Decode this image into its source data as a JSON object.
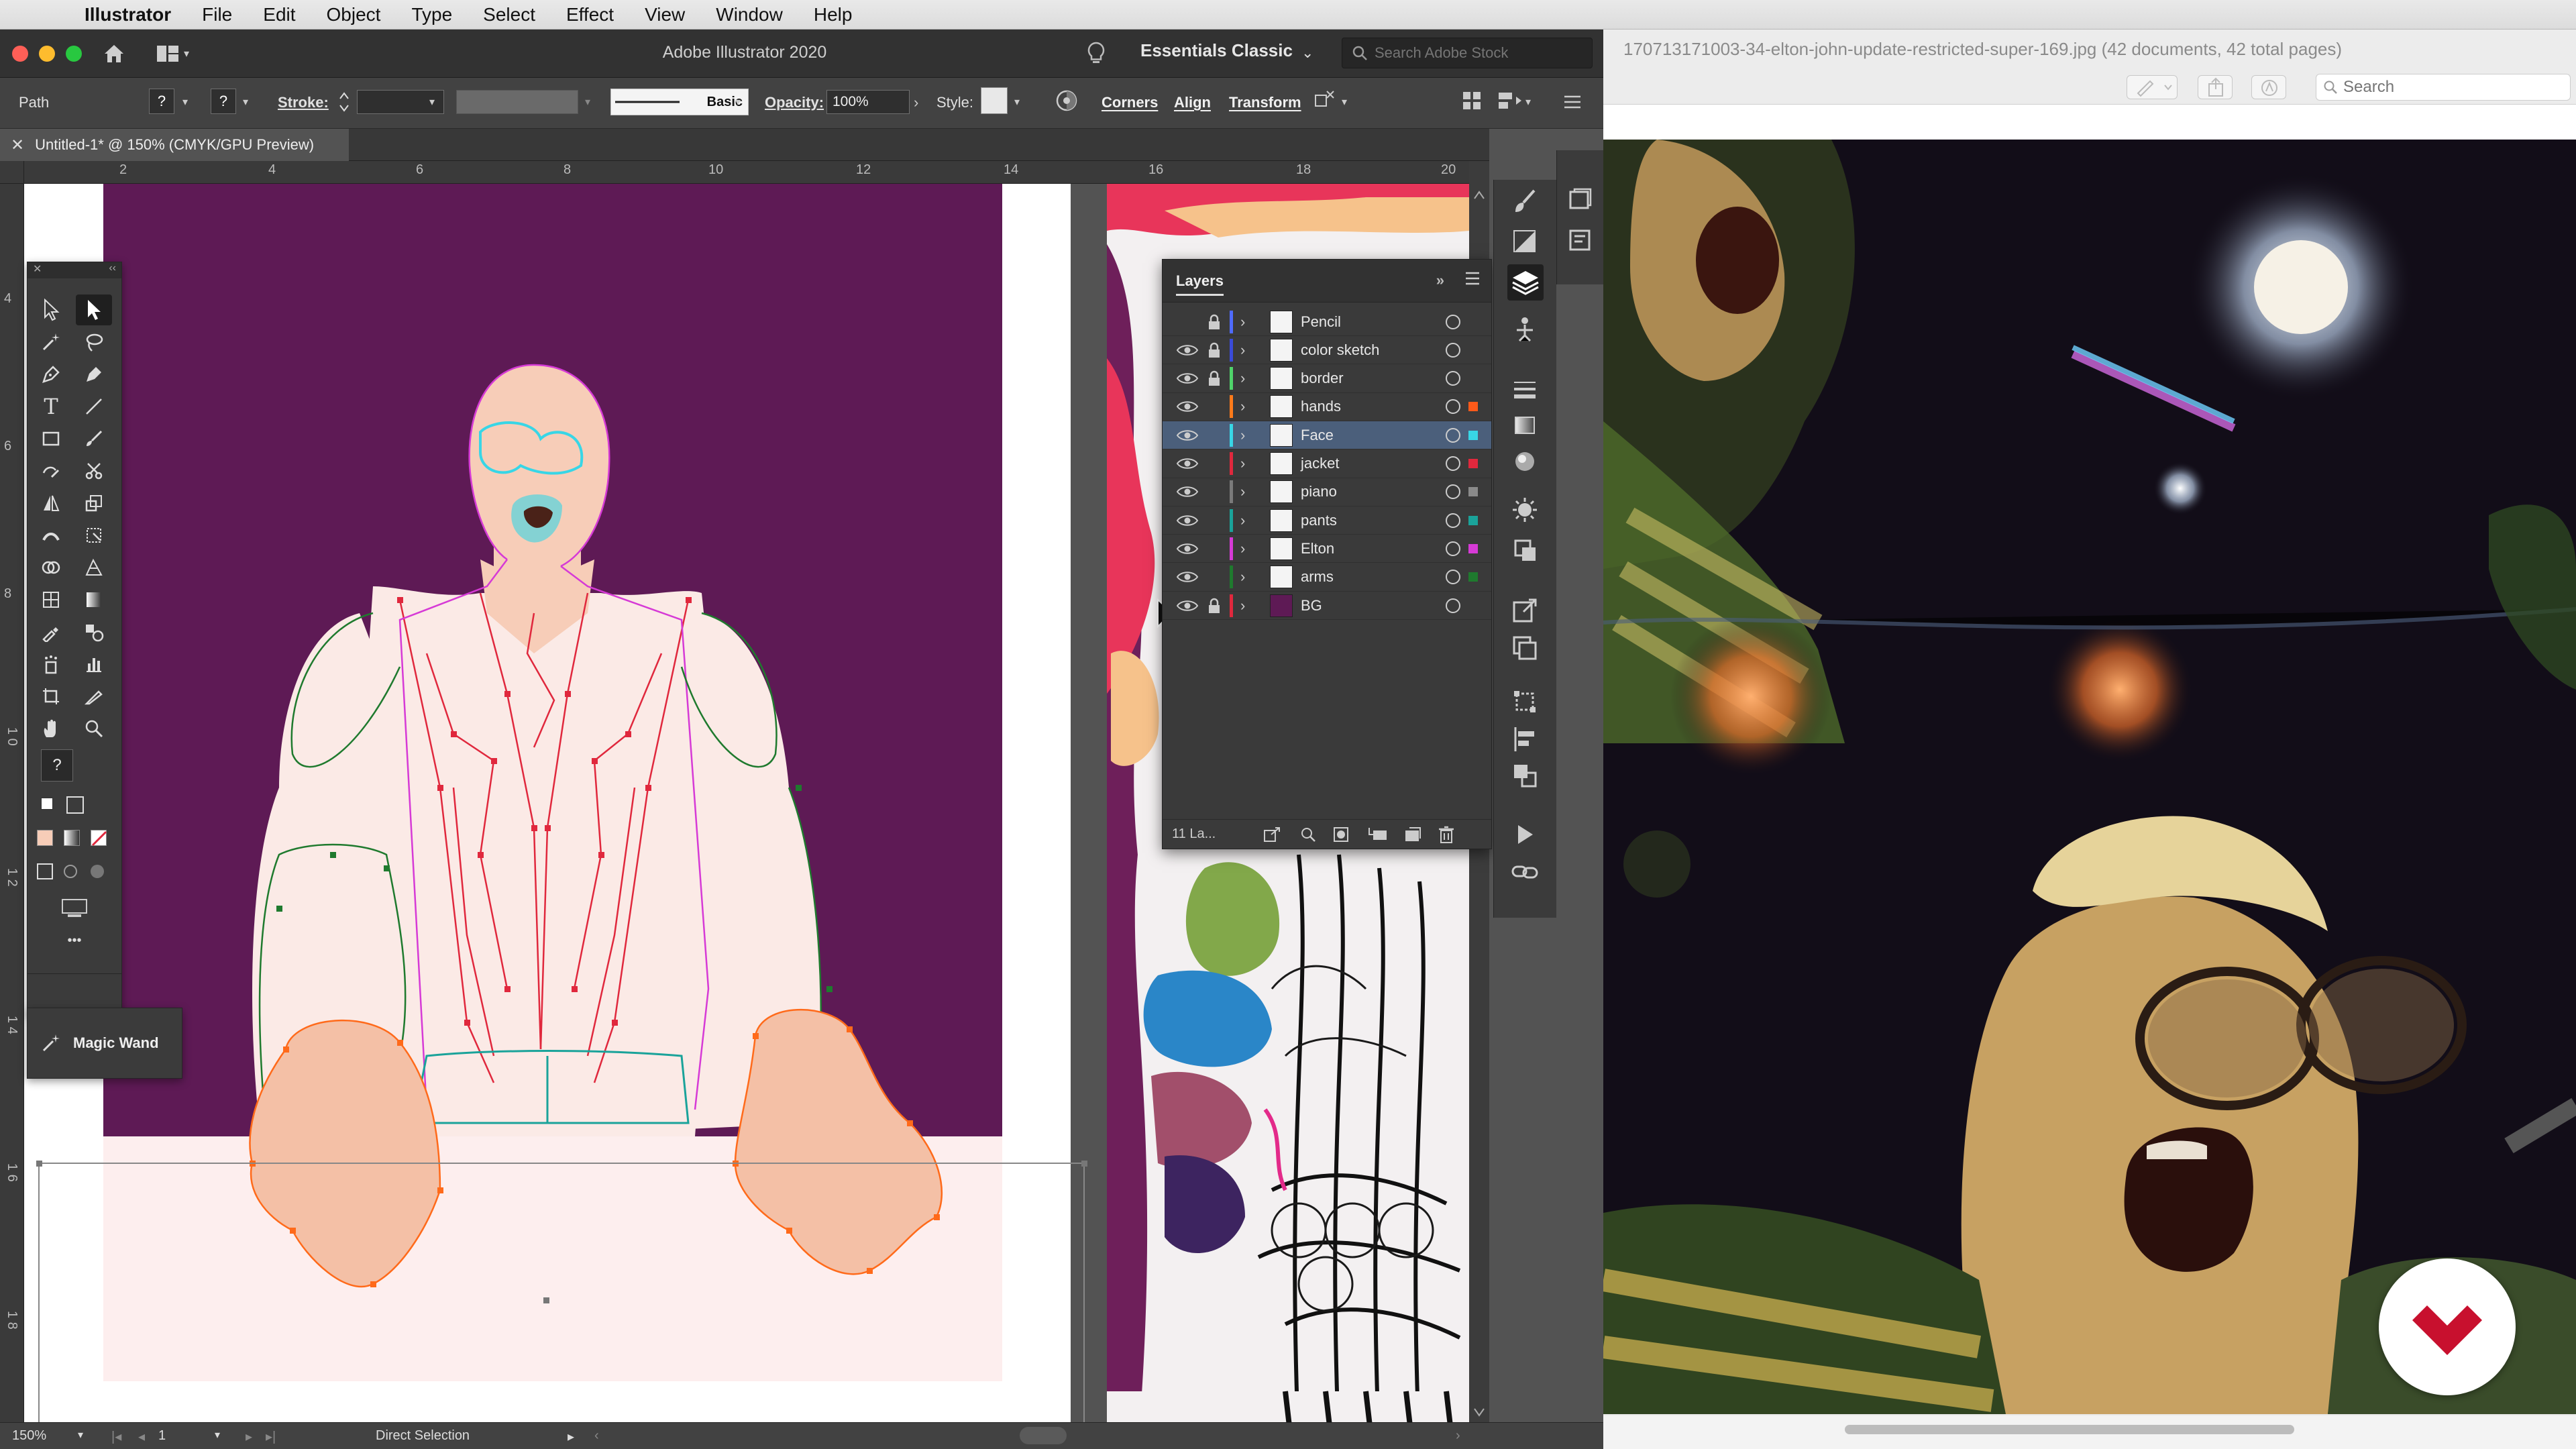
{
  "menubar": {
    "app_name": "Illustrator",
    "items": [
      "File",
      "Edit",
      "Object",
      "Type",
      "Select",
      "Effect",
      "View",
      "Window",
      "Help"
    ]
  },
  "window": {
    "title": "Adobe Illustrator 2020",
    "workspace": "Essentials Classic",
    "stock_search_placeholder": "Search Adobe Stock"
  },
  "control_bar": {
    "object_type": "Path",
    "stroke_label": "Stroke:",
    "brush_label": "Basic",
    "opacity_label": "Opacity:",
    "opacity_value": "100%",
    "style_label": "Style:",
    "corners_label": "Corners",
    "align_label": "Align",
    "transform_label": "Transform",
    "fill_unknown": "?",
    "stroke_unknown": "?"
  },
  "document_tab": {
    "title": "Untitled-1* @ 150% (CMYK/GPU Preview)"
  },
  "rulers": {
    "horizontal": [
      "2",
      "4",
      "6",
      "8",
      "10",
      "12",
      "14",
      "16",
      "18",
      "20"
    ],
    "vertical": [
      "4",
      "6",
      "8",
      "1 0",
      "1 2",
      "1 4",
      "1 6",
      "1 8"
    ]
  },
  "tools_panel": {
    "tooltip_label": "Magic Wand",
    "more_label": "•••",
    "help_label": "?"
  },
  "layers_panel": {
    "title": "Layers",
    "count_label": "11 La...",
    "layers": [
      {
        "name": "Pencil",
        "visible": false,
        "locked": true,
        "color": "#4f6bff",
        "selected": false,
        "sel_color": ""
      },
      {
        "name": "color sketch",
        "visible": true,
        "locked": true,
        "color": "#3a4bd8",
        "selected": false,
        "sel_color": ""
      },
      {
        "name": "border",
        "visible": true,
        "locked": true,
        "color": "#4fd36a",
        "selected": false,
        "sel_color": ""
      },
      {
        "name": "hands",
        "visible": true,
        "locked": false,
        "color": "#ff7a1a",
        "selected": false,
        "sel_color": "#ff5a1a"
      },
      {
        "name": "Face",
        "visible": true,
        "locked": false,
        "color": "#38d6e6",
        "selected": true,
        "sel_color": "#38d6e6"
      },
      {
        "name": "jacket",
        "visible": true,
        "locked": false,
        "color": "#e0283d",
        "selected": false,
        "sel_color": "#e0283d"
      },
      {
        "name": "piano",
        "visible": true,
        "locked": false,
        "color": "#7a7a7a",
        "selected": false,
        "sel_color": "#8a8a8a"
      },
      {
        "name": "pants",
        "visible": true,
        "locked": false,
        "color": "#1aa39a",
        "selected": false,
        "sel_color": "#1aa39a"
      },
      {
        "name": "Elton",
        "visible": true,
        "locked": false,
        "color": "#d63ad6",
        "selected": false,
        "sel_color": "#d63ad6"
      },
      {
        "name": "arms",
        "visible": true,
        "locked": false,
        "color": "#1f7a2e",
        "selected": false,
        "sel_color": "#1f7a2e"
      },
      {
        "name": "BG",
        "visible": true,
        "locked": true,
        "color": "#e0283d",
        "selected": false,
        "sel_color": ""
      }
    ]
  },
  "status_bar": {
    "zoom": "150%",
    "artboard": "1",
    "tool": "Direct Selection"
  },
  "preview": {
    "title": "170713171003-34-elton-john-update-restricted-super-169.jpg (42 documents, 42 total pages)",
    "search_placeholder": "Search"
  },
  "colors": {
    "artboard_bg": "#5e1a55",
    "skin": "#f7cdb8",
    "shirt": "#fbeae6",
    "piano_front": "#fdeeee",
    "selection_red": "#e0283d",
    "selection_cyan": "#38d6e6",
    "selection_orange": "#ff6a1a",
    "selection_green": "#1f7a2e",
    "selection_magenta": "#d63ad6",
    "ui_dark": "#323232",
    "ui_panel": "#3b3b3b"
  }
}
